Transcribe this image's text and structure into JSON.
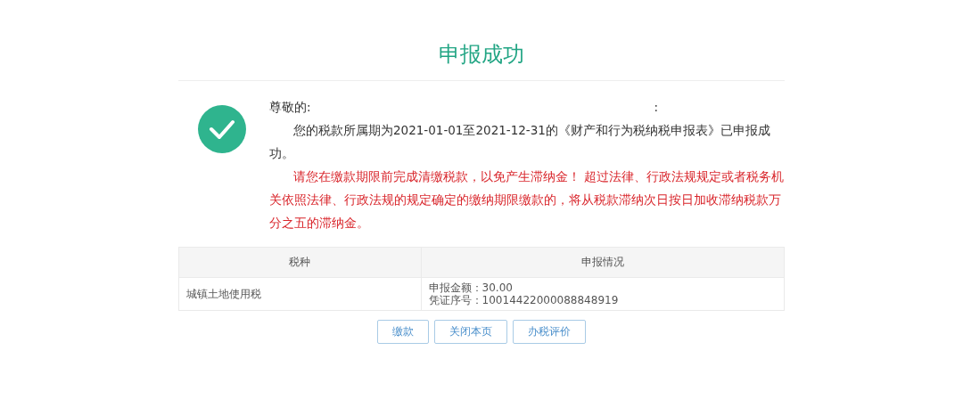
{
  "title": "申报成功",
  "message": {
    "greeting": "尊敬的:",
    "greeting_colon": ":",
    "body": "您的税款所属期为2021-01-01至2021-12-31的《财产和行为税纳税申报表》已申报成功。",
    "warning": "请您在缴款期限前完成清缴税款，以免产生滞纳金！ 超过法律、行政法规规定或者税务机关依照法律、行政法规的规定确定的缴纳期限缴款的，将从税款滞纳次日按日加收滞纳税款万分之五的滞纳金。"
  },
  "table": {
    "columns": [
      "税种",
      "申报情况"
    ],
    "rows": [
      {
        "tax_type": "城镇土地使用税",
        "details": [
          "申报金额：30.00",
          "凭证序号：10014422000088848919"
        ]
      }
    ]
  },
  "buttons": [
    "缴款",
    "关闭本页",
    "办税评价"
  ]
}
